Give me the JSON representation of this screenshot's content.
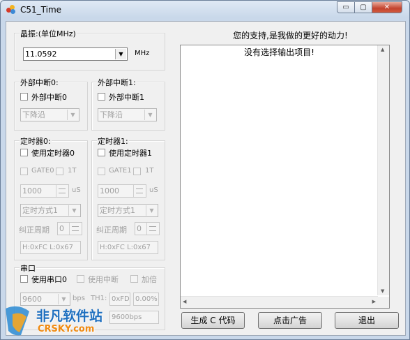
{
  "window": {
    "title": "C51_Time",
    "min_glyph": "▭",
    "max_glyph": "▢",
    "close_glyph": "✕"
  },
  "crystal": {
    "label": "晶振:(单位MHz)",
    "value": "11.0592",
    "unit": "MHz"
  },
  "int0": {
    "label": "外部中断0:",
    "checkbox": "外部中断0",
    "mode": "下降沿"
  },
  "int1": {
    "label": "外部中断1:",
    "checkbox": "外部中断1",
    "mode": "下降沿"
  },
  "timer0": {
    "label": "定时器0:",
    "checkbox": "使用定时器0",
    "gate": "GATE0",
    "tr": "1T",
    "time": "1000",
    "unit": "uS",
    "mode": "定时方式1",
    "correct_label": "纠正周期",
    "correct": "0",
    "result": "H:0xFC L:0x67"
  },
  "timer1": {
    "label": "定时器1:",
    "checkbox": "使用定时器1",
    "gate": "GATE1",
    "tr": "1T",
    "time": "1000",
    "unit": "uS",
    "mode": "定时方式1",
    "correct_label": "纠正周期",
    "correct": "0",
    "result": "H:0xFC L:0x67"
  },
  "serial": {
    "label": "串口",
    "use": "使用串口0",
    "use_int": "使用中断",
    "double": "加倍",
    "baud": "9600",
    "bps_label": "bps",
    "th1_label": "TH1:",
    "th1": "0xFD",
    "err": "0.00%",
    "actual": "9600bps"
  },
  "output": {
    "header": "您的支持,是我做的更好的动力!",
    "text": "没有选择输出项目!"
  },
  "buttons": {
    "generate": "生成 C 代码",
    "ad": "点击广告",
    "exit": "退出"
  },
  "watermark": {
    "cn": "非凡软件站",
    "en": "CRSKY.com"
  }
}
